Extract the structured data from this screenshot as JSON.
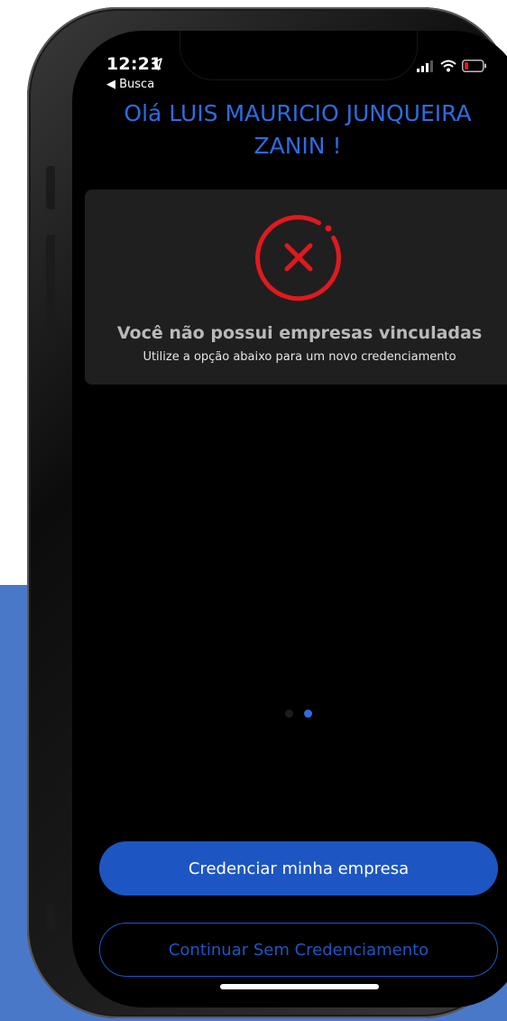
{
  "status_bar": {
    "time": "12:21",
    "back_label": "◀ Busca"
  },
  "greeting": {
    "line1": "Olá LUIS MAURICIO JUNQUEIRA",
    "line2": "ZANIN !"
  },
  "empty_state": {
    "icon": "x-circle-icon",
    "title": "Você não possui empresas vinculadas",
    "subtitle": "Utilize a opção abaixo para um novo credenciamento"
  },
  "pagination": {
    "count": 2,
    "active_index": 1
  },
  "actions": {
    "primary_label": "Credenciar minha empresa",
    "secondary_label": "Continuar Sem Credenciamento"
  },
  "colors": {
    "accent": "#2f6be0",
    "button": "#1d56c2",
    "error": "#e0191f",
    "card": "#1f1f1f",
    "backdrop": "#4a78c9"
  }
}
